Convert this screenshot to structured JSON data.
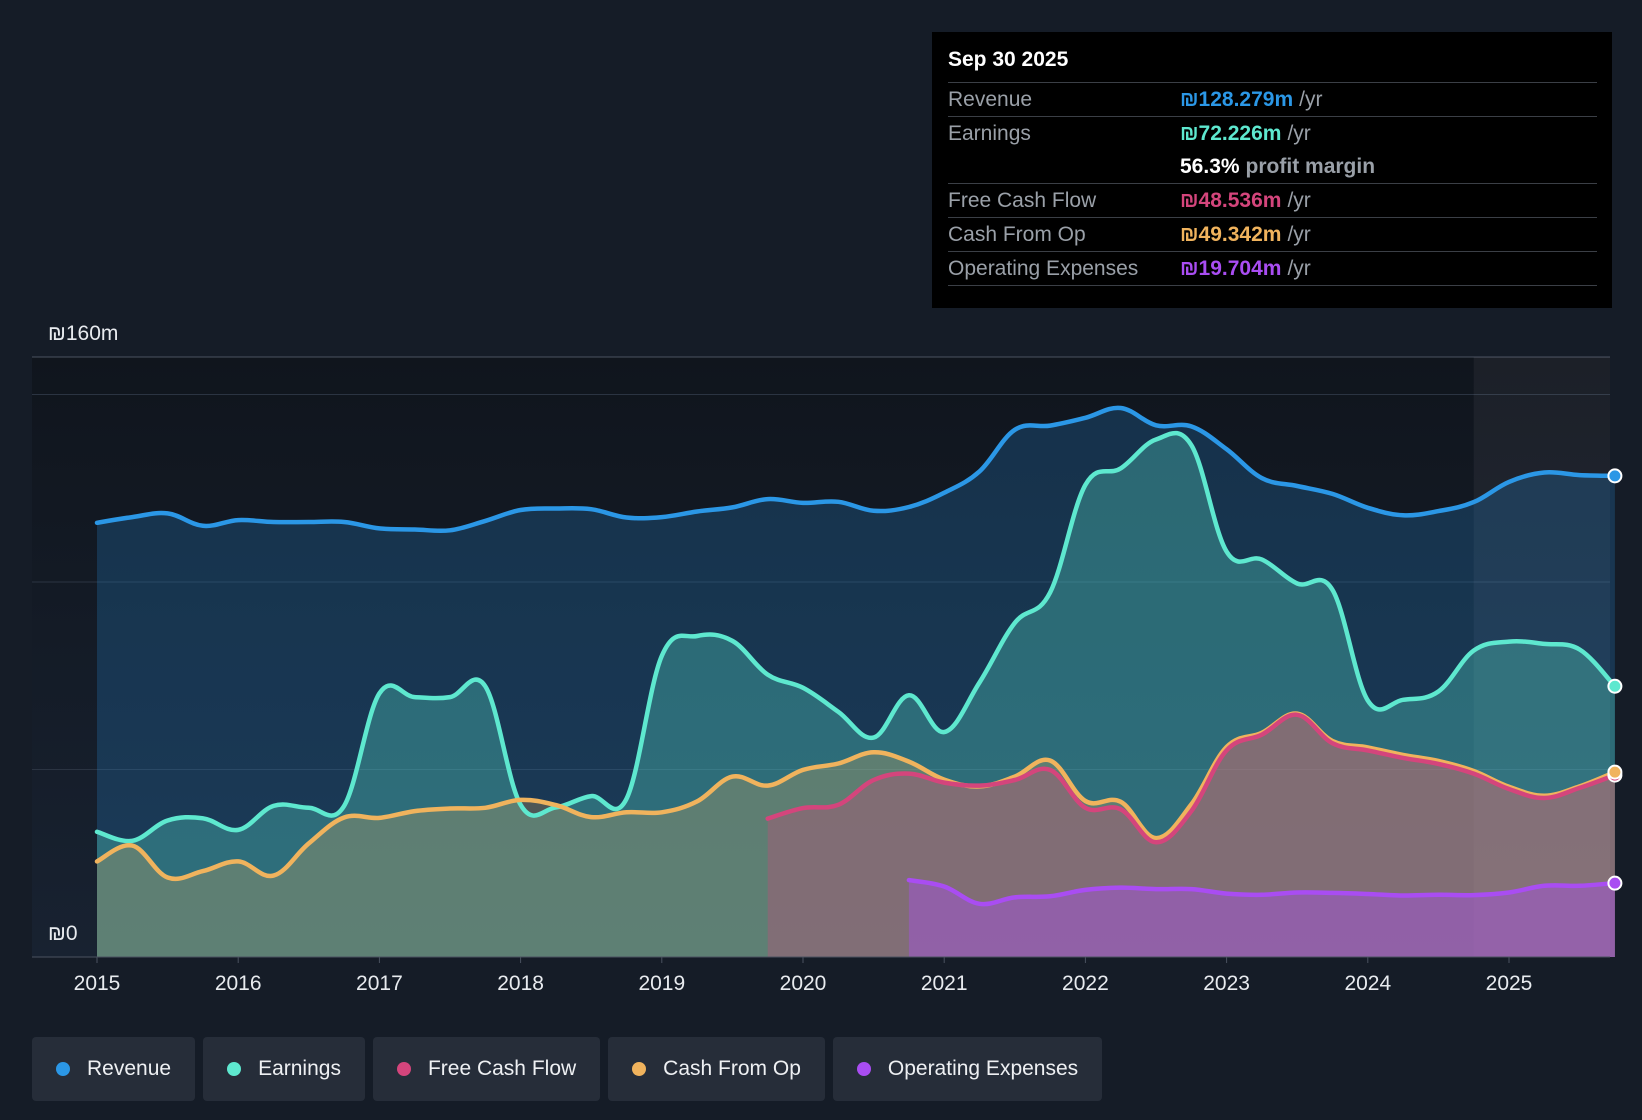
{
  "tooltip": {
    "date": "Sep 30 2025",
    "rows": [
      {
        "name": "Revenue",
        "value": "₪128.279m",
        "unit": "/yr",
        "color": "#2b97e6"
      },
      {
        "name": "Earnings",
        "value": "₪72.226m",
        "unit": "/yr",
        "color": "#5ee8cf"
      },
      {
        "name": "Free Cash Flow",
        "value": "₪48.536m",
        "unit": "/yr",
        "color": "#d4457c"
      },
      {
        "name": "Cash From Op",
        "value": "₪49.342m",
        "unit": "/yr",
        "color": "#f0b35d"
      },
      {
        "name": "Operating Expenses",
        "value": "₪19.704m",
        "unit": "/yr",
        "color": "#a94df2"
      }
    ],
    "margin_value": "56.3%",
    "margin_text": "profit margin"
  },
  "legend": [
    {
      "label": "Revenue",
      "color": "#2b97e6"
    },
    {
      "label": "Earnings",
      "color": "#5ee8cf"
    },
    {
      "label": "Free Cash Flow",
      "color": "#d4457c"
    },
    {
      "label": "Cash From Op",
      "color": "#f0b35d"
    },
    {
      "label": "Operating Expenses",
      "color": "#a94df2"
    }
  ],
  "chart_data": {
    "type": "area",
    "title": "",
    "xlabel": "",
    "ylabel": "",
    "y_axis_labels": [
      "₪160m",
      "₪0"
    ],
    "ylim": [
      0,
      160
    ],
    "xlim": [
      2014.5,
      2025.75
    ],
    "x_ticks": [
      "2015",
      "2016",
      "2017",
      "2018",
      "2019",
      "2020",
      "2021",
      "2022",
      "2023",
      "2024",
      "2025"
    ],
    "grid": true,
    "forecast_shade_from": 2024.75,
    "legend_position": "bottom",
    "series": [
      {
        "name": "Revenue",
        "color": "#2b97e6",
        "points": [
          [
            2015,
            115.8
          ],
          [
            2015.25,
            117.3
          ],
          [
            2015.5,
            118.3
          ],
          [
            2015.75,
            115
          ],
          [
            2016,
            116.5
          ],
          [
            2016.25,
            116
          ],
          [
            2016.5,
            116
          ],
          [
            2016.75,
            116
          ],
          [
            2017,
            114.3
          ],
          [
            2017.25,
            114
          ],
          [
            2017.5,
            113.8
          ],
          [
            2017.75,
            116.3
          ],
          [
            2018,
            119.2
          ],
          [
            2018.25,
            119.6
          ],
          [
            2018.5,
            119.4
          ],
          [
            2018.75,
            117.2
          ],
          [
            2019,
            117.3
          ],
          [
            2019.25,
            118.8
          ],
          [
            2019.5,
            119.9
          ],
          [
            2019.75,
            122.1
          ],
          [
            2020,
            121.1
          ],
          [
            2020.25,
            121.4
          ],
          [
            2020.5,
            119
          ],
          [
            2020.75,
            120
          ],
          [
            2021,
            123.8
          ],
          [
            2021.25,
            129.5
          ],
          [
            2021.5,
            140.6
          ],
          [
            2021.75,
            141.7
          ],
          [
            2022,
            143.8
          ],
          [
            2022.25,
            146.4
          ],
          [
            2022.5,
            141.8
          ],
          [
            2022.75,
            141.5
          ],
          [
            2023,
            135.4
          ],
          [
            2023.25,
            127.7
          ],
          [
            2023.5,
            125.6
          ],
          [
            2023.75,
            123.5
          ],
          [
            2024,
            119.8
          ],
          [
            2024.25,
            117.8
          ],
          [
            2024.5,
            118.9
          ],
          [
            2024.75,
            121.3
          ],
          [
            2025,
            126.7
          ],
          [
            2025.25,
            129.2
          ],
          [
            2025.5,
            128.5
          ],
          [
            2025.75,
            128.3
          ]
        ]
      },
      {
        "name": "Earnings",
        "color": "#5ee8cf",
        "points": [
          [
            2015,
            33.4
          ],
          [
            2015.25,
            31
          ],
          [
            2015.5,
            36.4
          ],
          [
            2015.75,
            37
          ],
          [
            2016,
            33.9
          ],
          [
            2016.25,
            40.3
          ],
          [
            2016.5,
            39.8
          ],
          [
            2016.75,
            40.3
          ],
          [
            2017,
            70.3
          ],
          [
            2017.25,
            69.3
          ],
          [
            2017.5,
            69.3
          ],
          [
            2017.75,
            72.2
          ],
          [
            2018,
            40.6
          ],
          [
            2018.25,
            39.9
          ],
          [
            2018.5,
            42.9
          ],
          [
            2018.75,
            42.2
          ],
          [
            2019,
            80.3
          ],
          [
            2019.25,
            85.6
          ],
          [
            2019.5,
            84.3
          ],
          [
            2019.75,
            75.3
          ],
          [
            2020,
            71.8
          ],
          [
            2020.25,
            65.4
          ],
          [
            2020.5,
            58.5
          ],
          [
            2020.75,
            69.8
          ],
          [
            2021,
            60
          ],
          [
            2021.25,
            73.2
          ],
          [
            2021.5,
            89.1
          ],
          [
            2021.75,
            97.2
          ],
          [
            2022,
            125.9
          ],
          [
            2022.25,
            130.3
          ],
          [
            2022.5,
            138
          ],
          [
            2022.75,
            136.5
          ],
          [
            2023,
            108.1
          ],
          [
            2023.25,
            106
          ],
          [
            2023.5,
            99.6
          ],
          [
            2023.75,
            97.9
          ],
          [
            2024,
            68.4
          ],
          [
            2024.25,
            68.6
          ],
          [
            2024.5,
            70.8
          ],
          [
            2024.75,
            81.7
          ],
          [
            2025,
            84.1
          ],
          [
            2025.25,
            83.5
          ],
          [
            2025.5,
            82
          ],
          [
            2025.75,
            72.2
          ]
        ]
      },
      {
        "name": "Free Cash Flow",
        "color": "#d4457c",
        "points": [
          [
            2019.75,
            36.9
          ],
          [
            2020,
            39.7
          ],
          [
            2020.25,
            40.6
          ],
          [
            2020.5,
            47.2
          ],
          [
            2020.75,
            48.9
          ],
          [
            2021,
            46.5
          ],
          [
            2021.25,
            45.7
          ],
          [
            2021.5,
            47.2
          ],
          [
            2021.75,
            49.9
          ],
          [
            2022,
            39.8
          ],
          [
            2022.25,
            39.4
          ],
          [
            2022.5,
            30.6
          ],
          [
            2022.75,
            38.9
          ],
          [
            2023,
            55.1
          ],
          [
            2023.25,
            59.3
          ],
          [
            2023.5,
            64.6
          ],
          [
            2023.75,
            57
          ],
          [
            2024,
            55.1
          ],
          [
            2024.25,
            53.1
          ],
          [
            2024.5,
            51.5
          ],
          [
            2024.75,
            48.9
          ],
          [
            2025,
            44.8
          ],
          [
            2025.25,
            42.4
          ],
          [
            2025.5,
            45.1
          ],
          [
            2025.75,
            48.5
          ]
        ]
      },
      {
        "name": "Cash From Op",
        "color": "#f0b35d",
        "points": [
          [
            2015,
            25.5
          ],
          [
            2015.25,
            29.7
          ],
          [
            2015.5,
            21.2
          ],
          [
            2015.75,
            22.9
          ],
          [
            2016,
            25.5
          ],
          [
            2016.25,
            21.7
          ],
          [
            2016.5,
            30.3
          ],
          [
            2016.75,
            37.2
          ],
          [
            2017,
            37.1
          ],
          [
            2017.25,
            38.9
          ],
          [
            2017.5,
            39.6
          ],
          [
            2017.75,
            39.8
          ],
          [
            2018,
            41.9
          ],
          [
            2018.25,
            40.5
          ],
          [
            2018.5,
            37.3
          ],
          [
            2018.75,
            38.6
          ],
          [
            2019,
            38.6
          ],
          [
            2019.25,
            41.5
          ],
          [
            2019.5,
            48.1
          ],
          [
            2019.75,
            45.7
          ],
          [
            2020,
            49.9
          ],
          [
            2020.25,
            51.6
          ],
          [
            2020.5,
            54.6
          ],
          [
            2020.75,
            52.1
          ],
          [
            2021,
            47.3
          ],
          [
            2021.25,
            45.5
          ],
          [
            2021.5,
            48.1
          ],
          [
            2021.75,
            52.4
          ],
          [
            2022,
            41.6
          ],
          [
            2022.25,
            41.4
          ],
          [
            2022.5,
            31.7
          ],
          [
            2022.75,
            40.7
          ],
          [
            2023,
            56
          ],
          [
            2023.25,
            59.8
          ],
          [
            2023.5,
            64.9
          ],
          [
            2023.75,
            57.6
          ],
          [
            2024,
            55.9
          ],
          [
            2024.25,
            53.9
          ],
          [
            2024.5,
            52.3
          ],
          [
            2024.75,
            49.6
          ],
          [
            2025,
            45.4
          ],
          [
            2025.25,
            43
          ],
          [
            2025.5,
            45.5
          ],
          [
            2025.75,
            49.3
          ]
        ]
      },
      {
        "name": "Operating Expenses",
        "color": "#a94df2",
        "points": [
          [
            2020.75,
            20.5
          ],
          [
            2021,
            18.8
          ],
          [
            2021.25,
            14.2
          ],
          [
            2021.5,
            15.9
          ],
          [
            2021.75,
            16.2
          ],
          [
            2022,
            17.9
          ],
          [
            2022.25,
            18.5
          ],
          [
            2022.5,
            18.1
          ],
          [
            2022.75,
            18.1
          ],
          [
            2023,
            16.9
          ],
          [
            2023.25,
            16.6
          ],
          [
            2023.5,
            17.2
          ],
          [
            2023.75,
            17.1
          ],
          [
            2024,
            16.8
          ],
          [
            2024.25,
            16.4
          ],
          [
            2024.5,
            16.6
          ],
          [
            2024.75,
            16.5
          ],
          [
            2025,
            17.2
          ],
          [
            2025.25,
            19
          ],
          [
            2025.5,
            19
          ],
          [
            2025.75,
            19.7
          ]
        ]
      }
    ]
  }
}
